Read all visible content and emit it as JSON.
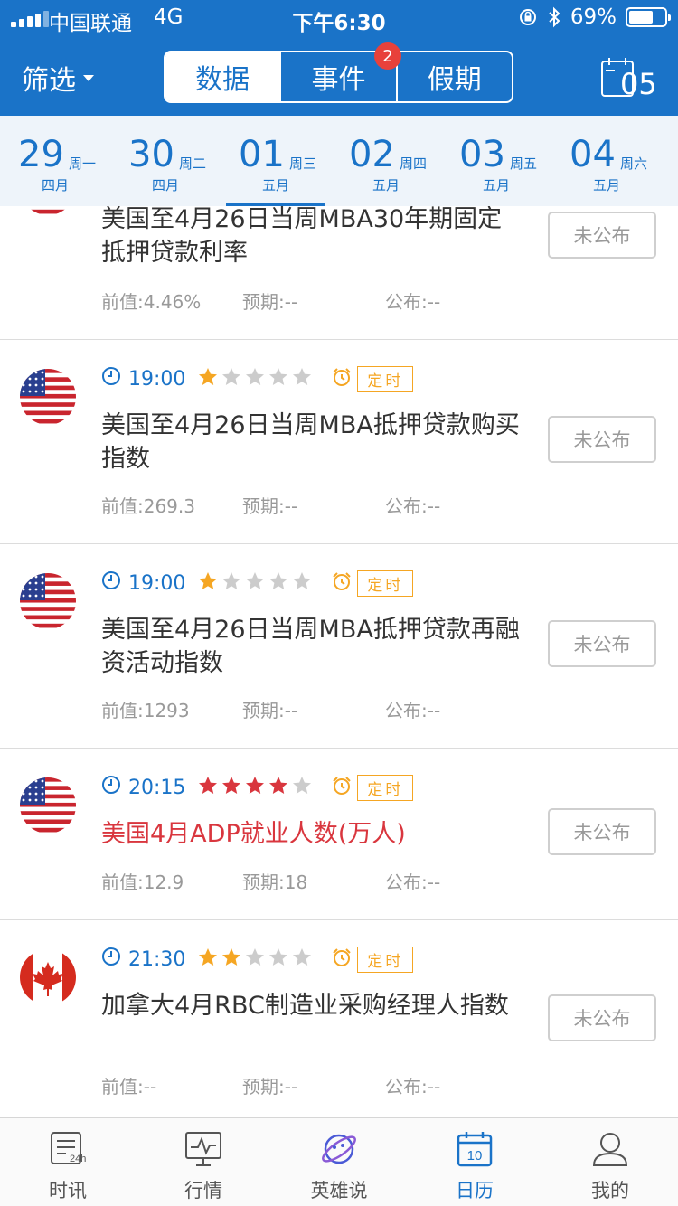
{
  "status_bar": {
    "carrier": "中国联通",
    "network": "4G",
    "time": "下午6:30",
    "battery": "69%",
    "battery_level": 0.69
  },
  "nav": {
    "filter_label": "筛选",
    "tabs": [
      {
        "label": "数据",
        "active": true
      },
      {
        "label": "事件",
        "active": false
      },
      {
        "label": "假期",
        "active": false
      }
    ],
    "event_badge": "2",
    "calendar_day": "05"
  },
  "dates": [
    {
      "day": "29",
      "weekday": "周一",
      "month": "四月",
      "active": false
    },
    {
      "day": "30",
      "weekday": "周二",
      "month": "四月",
      "active": false
    },
    {
      "day": "01",
      "weekday": "周三",
      "month": "五月",
      "active": true
    },
    {
      "day": "02",
      "weekday": "周四",
      "month": "五月",
      "active": false
    },
    {
      "day": "03",
      "weekday": "周五",
      "month": "五月",
      "active": false
    },
    {
      "day": "04",
      "weekday": "周六",
      "month": "五月",
      "active": false
    }
  ],
  "events": [
    {
      "country": "US",
      "title": "美国至4月26日当周MBA30年期固定抵押贷款利率",
      "prev": "前值:4.46%",
      "forecast": "预期:--",
      "actual": "公布:--",
      "status": "未公布"
    },
    {
      "country": "US",
      "time": "19:00",
      "stars": 1,
      "star_color": "#f5a623",
      "timer": "定时",
      "title": "美国至4月26日当周MBA抵押贷款购买指数",
      "prev": "前值:269.3",
      "forecast": "预期:--",
      "actual": "公布:--",
      "status": "未公布"
    },
    {
      "country": "US",
      "time": "19:00",
      "stars": 1,
      "star_color": "#f5a623",
      "timer": "定时",
      "title": "美国至4月26日当周MBA抵押贷款再融资活动指数",
      "prev": "前值:1293",
      "forecast": "预期:--",
      "actual": "公布:--",
      "status": "未公布"
    },
    {
      "country": "US",
      "time": "20:15",
      "stars": 4,
      "star_color": "#d9363e",
      "timer": "定时",
      "title": "美国4月ADP就业人数(万人)",
      "highlight": true,
      "prev": "前值:12.9",
      "forecast": "预期:18",
      "actual": "公布:--",
      "status": "未公布"
    },
    {
      "country": "CA",
      "time": "21:30",
      "stars": 2,
      "star_color": "#f5a623",
      "timer": "定时",
      "title": "加拿大4月RBC制造业采购经理人指数",
      "prev": "前值:--",
      "forecast": "预期:--",
      "actual": "公布:--",
      "status": "未公布"
    }
  ],
  "tabbar": [
    {
      "label": "时讯",
      "icon": "news-icon",
      "active": false
    },
    {
      "label": "行情",
      "icon": "market-icon",
      "active": false
    },
    {
      "label": "英雄说",
      "icon": "planet-icon",
      "active": false
    },
    {
      "label": "日历",
      "icon": "calendar-icon",
      "active": true
    },
    {
      "label": "我的",
      "icon": "profile-icon",
      "active": false
    }
  ],
  "tab_icon_texts": {
    "news_sub": "24h",
    "calendar_day": "10"
  },
  "colors": {
    "brand": "#1a73c8",
    "star_gold": "#f5a623",
    "star_red": "#d9363e",
    "badge": "#e8413b"
  }
}
